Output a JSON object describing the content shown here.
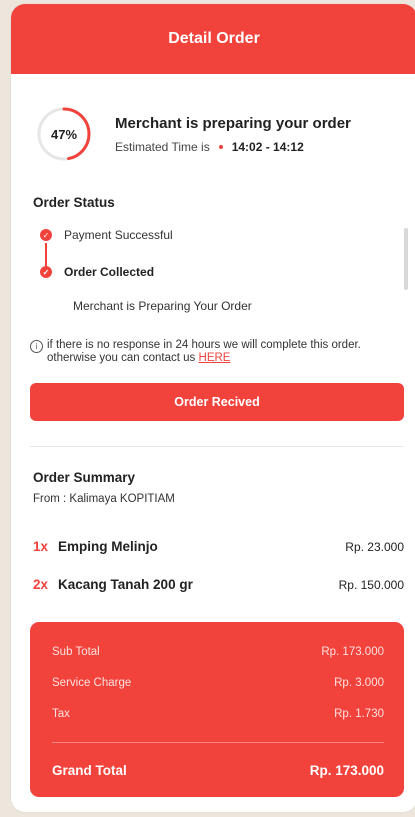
{
  "header": {
    "title": "Detail Order"
  },
  "progress": {
    "percent": 47,
    "label": "47%"
  },
  "preparing": {
    "title": "Merchant is preparing your order",
    "est_label": "Estimated Time is",
    "est_time": "14:02 - 14:12"
  },
  "order_status": {
    "title": "Order Status",
    "items": [
      {
        "label": "Payment Successful"
      },
      {
        "label": "Order Collected"
      },
      {
        "label": "Merchant is Preparing Your Order"
      }
    ]
  },
  "info": {
    "text": "if there is no response in 24 hours we will complete this order. otherwise you can contact us",
    "link": "HERE"
  },
  "button": {
    "label": "Order Recived"
  },
  "summary": {
    "title": "Order Summary",
    "from": "From : Kalimaya KOPITIAM",
    "items": [
      {
        "qty": "1x",
        "name": "Emping Melinjo",
        "price": "Rp. 23.000"
      },
      {
        "qty": "2x",
        "name": "Kacang Tanah 200 gr",
        "price": "Rp. 150.000"
      }
    ],
    "rows": [
      {
        "label": "Sub Total",
        "value": "Rp. 173.000"
      },
      {
        "label": "Service Charge",
        "value": "Rp. 3.000"
      },
      {
        "label": "Tax",
        "value": "Rp. 1.730"
      }
    ],
    "grand_label": "Grand Total",
    "grand_value": "Rp. 173.000"
  },
  "colors": {
    "accent": "#f1433c",
    "track": "#e6e6e6"
  }
}
